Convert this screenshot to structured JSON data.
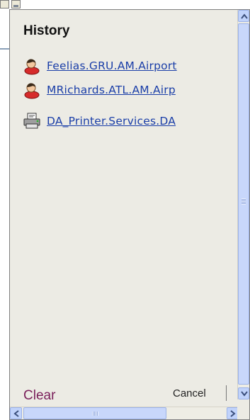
{
  "panel": {
    "title": "History",
    "items": [
      {
        "label": "Feelias.GRU.AM.Airport",
        "icon": "user-icon"
      },
      {
        "label": "MRichards.ATL.AM.Airp",
        "icon": "user-icon"
      },
      {
        "label": "DA_Printer.Services.DA",
        "icon": "printer-icon"
      }
    ],
    "clear_label": "Clear",
    "cancel_label": "Cancel"
  },
  "colors": {
    "panel_bg": "#ecebe4",
    "link": "#1a3ea8",
    "clear": "#7a1f5a",
    "scrollbar": "#c8d7fb"
  }
}
